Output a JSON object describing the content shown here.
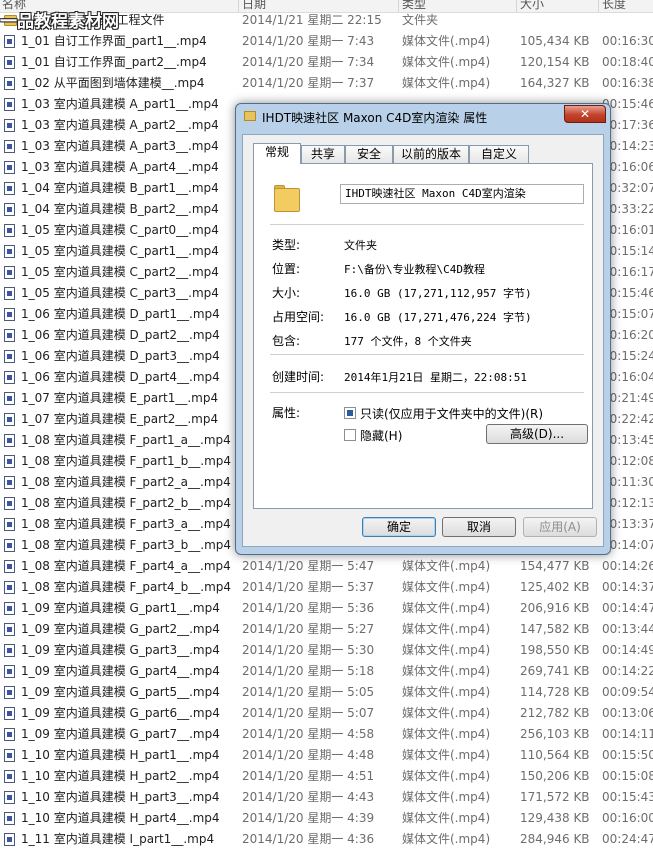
{
  "watermark": "一品教程素材网",
  "columns": {
    "name": "名称",
    "date": "日期",
    "type": "类型",
    "size": "大小",
    "duration": "长度"
  },
  "files": [
    {
      "name": "CINEMA 4D 室内工程文件",
      "date": "2014/1/21 星期二 22:15",
      "type": "文件夹",
      "size": "",
      "duration": "",
      "kind": "folder-icon"
    },
    {
      "name": "1_01 自订工作界面_part1__.mp4",
      "date": "2014/1/20 星期一 7:43",
      "type": "媒体文件(.mp4)",
      "size": "105,434 KB",
      "duration": "00:16:30",
      "kind": "media-file-icon"
    },
    {
      "name": "1_01 自订工作界面_part2__.mp4",
      "date": "2014/1/20 星期一 7:34",
      "type": "媒体文件(.mp4)",
      "size": "120,154 KB",
      "duration": "00:18:40",
      "kind": "media-file-icon"
    },
    {
      "name": "1_02 从平面图到墙体建模__.mp4",
      "date": "2014/1/20 星期一 7:37",
      "type": "媒体文件(.mp4)",
      "size": "164,327 KB",
      "duration": "00:16:38",
      "kind": "media-file-icon"
    },
    {
      "name": "1_03 室内道具建模 A_part1__.mp4",
      "date": "",
      "type": "",
      "size": "",
      "duration": "00:15:46",
      "kind": "media-file-icon"
    },
    {
      "name": "1_03 室内道具建模 A_part2__.mp4",
      "date": "",
      "type": "",
      "size": "",
      "duration": "00:17:36",
      "kind": "media-file-icon"
    },
    {
      "name": "1_03 室内道具建模 A_part3__.mp4",
      "date": "",
      "type": "",
      "size": "",
      "duration": "00:14:23",
      "kind": "media-file-icon"
    },
    {
      "name": "1_03 室内道具建模 A_part4__.mp4",
      "date": "",
      "type": "",
      "size": "",
      "duration": "00:16:06",
      "kind": "media-file-icon"
    },
    {
      "name": "1_04 室内道具建模 B_part1__.mp4",
      "date": "",
      "type": "",
      "size": "",
      "duration": "00:32:07",
      "kind": "media-file-icon"
    },
    {
      "name": "1_04 室内道具建模 B_part2__.mp4",
      "date": "",
      "type": "",
      "size": "",
      "duration": "00:33:22",
      "kind": "media-file-icon"
    },
    {
      "name": "1_05 室内道具建模 C_part0__.mp4",
      "date": "",
      "type": "",
      "size": "",
      "duration": "00:16:01",
      "kind": "media-file-icon"
    },
    {
      "name": "1_05 室内道具建模 C_part1__.mp4",
      "date": "",
      "type": "",
      "size": "",
      "duration": "00:15:14",
      "kind": "media-file-icon"
    },
    {
      "name": "1_05 室内道具建模 C_part2__.mp4",
      "date": "",
      "type": "",
      "size": "",
      "duration": "00:16:17",
      "kind": "media-file-icon"
    },
    {
      "name": "1_05 室内道具建模 C_part3__.mp4",
      "date": "",
      "type": "",
      "size": "",
      "duration": "00:15:46",
      "kind": "media-file-icon"
    },
    {
      "name": "1_06 室内道具建模 D_part1__.mp4",
      "date": "",
      "type": "",
      "size": "",
      "duration": "00:15:07",
      "kind": "media-file-icon"
    },
    {
      "name": "1_06 室内道具建模 D_part2__.mp4",
      "date": "",
      "type": "",
      "size": "",
      "duration": "00:16:20",
      "kind": "media-file-icon"
    },
    {
      "name": "1_06 室内道具建模 D_part3__.mp4",
      "date": "",
      "type": "",
      "size": "",
      "duration": "00:15:24",
      "kind": "media-file-icon"
    },
    {
      "name": "1_06 室内道具建模 D_part4__.mp4",
      "date": "",
      "type": "",
      "size": "",
      "duration": "00:16:04",
      "kind": "media-file-icon"
    },
    {
      "name": "1_07 室内道具建模 E_part1__.mp4",
      "date": "",
      "type": "",
      "size": "",
      "duration": "00:21:49",
      "kind": "media-file-icon"
    },
    {
      "name": "1_07 室内道具建模 E_part2__.mp4",
      "date": "",
      "type": "",
      "size": "",
      "duration": "00:22:42",
      "kind": "media-file-icon"
    },
    {
      "name": "1_08 室内道具建模 F_part1_a__.mp4",
      "date": "",
      "type": "",
      "size": "",
      "duration": "00:13:45",
      "kind": "media-file-icon"
    },
    {
      "name": "1_08 室内道具建模 F_part1_b__.mp4",
      "date": "",
      "type": "",
      "size": "",
      "duration": "00:12:08",
      "kind": "media-file-icon"
    },
    {
      "name": "1_08 室内道具建模 F_part2_a__.mp4",
      "date": "",
      "type": "",
      "size": "",
      "duration": "00:11:30",
      "kind": "media-file-icon"
    },
    {
      "name": "1_08 室内道具建模 F_part2_b__.mp4",
      "date": "",
      "type": "",
      "size": "",
      "duration": "00:12:13",
      "kind": "media-file-icon"
    },
    {
      "name": "1_08 室内道具建模 F_part3_a__.mp4",
      "date": "",
      "type": "",
      "size": "",
      "duration": "00:13:37",
      "kind": "media-file-icon"
    },
    {
      "name": "1_08 室内道具建模 F_part3_b__.mp4",
      "date": "",
      "type": "",
      "size": "",
      "duration": "00:14:07",
      "kind": "media-file-icon"
    },
    {
      "name": "1_08 室内道具建模 F_part4_a__.mp4",
      "date": "2014/1/20 星期一 5:47",
      "type": "媒体文件(.mp4)",
      "size": "154,477 KB",
      "duration": "00:14:26",
      "kind": "media-file-icon"
    },
    {
      "name": "1_08 室内道具建模 F_part4_b__.mp4",
      "date": "2014/1/20 星期一 5:37",
      "type": "媒体文件(.mp4)",
      "size": "125,402 KB",
      "duration": "00:14:37",
      "kind": "media-file-icon"
    },
    {
      "name": "1_09 室内道具建模 G_part1__.mp4",
      "date": "2014/1/20 星期一 5:36",
      "type": "媒体文件(.mp4)",
      "size": "206,916 KB",
      "duration": "00:14:47",
      "kind": "media-file-icon"
    },
    {
      "name": "1_09 室内道具建模 G_part2__.mp4",
      "date": "2014/1/20 星期一 5:27",
      "type": "媒体文件(.mp4)",
      "size": "147,582 KB",
      "duration": "00:13:44",
      "kind": "media-file-icon"
    },
    {
      "name": "1_09 室内道具建模 G_part3__.mp4",
      "date": "2014/1/20 星期一 5:30",
      "type": "媒体文件(.mp4)",
      "size": "198,550 KB",
      "duration": "00:14:49",
      "kind": "media-file-icon"
    },
    {
      "name": "1_09 室内道具建模 G_part4__.mp4",
      "date": "2014/1/20 星期一 5:18",
      "type": "媒体文件(.mp4)",
      "size": "269,741 KB",
      "duration": "00:14:22",
      "kind": "media-file-icon"
    },
    {
      "name": "1_09 室内道具建模 G_part5__.mp4",
      "date": "2014/1/20 星期一 5:05",
      "type": "媒体文件(.mp4)",
      "size": "114,728 KB",
      "duration": "00:09:54",
      "kind": "media-file-icon"
    },
    {
      "name": "1_09 室内道具建模 G_part6__.mp4",
      "date": "2014/1/20 星期一 5:07",
      "type": "媒体文件(.mp4)",
      "size": "212,782 KB",
      "duration": "00:13:06",
      "kind": "media-file-icon"
    },
    {
      "name": "1_09 室内道具建模 G_part7__.mp4",
      "date": "2014/1/20 星期一 4:58",
      "type": "媒体文件(.mp4)",
      "size": "256,103 KB",
      "duration": "00:14:11",
      "kind": "media-file-icon"
    },
    {
      "name": "1_10 室内道具建模 H_part1__.mp4",
      "date": "2014/1/20 星期一 4:48",
      "type": "媒体文件(.mp4)",
      "size": "110,564 KB",
      "duration": "00:15:50",
      "kind": "media-file-icon"
    },
    {
      "name": "1_10 室内道具建模 H_part2__.mp4",
      "date": "2014/1/20 星期一 4:51",
      "type": "媒体文件(.mp4)",
      "size": "150,206 KB",
      "duration": "00:15:08",
      "kind": "media-file-icon"
    },
    {
      "name": "1_10 室内道具建模 H_part3__.mp4",
      "date": "2014/1/20 星期一 4:43",
      "type": "媒体文件(.mp4)",
      "size": "171,572 KB",
      "duration": "00:15:43",
      "kind": "media-file-icon"
    },
    {
      "name": "1_10 室内道具建模 H_part4__.mp4",
      "date": "2014/1/20 星期一 4:39",
      "type": "媒体文件(.mp4)",
      "size": "129,438 KB",
      "duration": "00:16:00",
      "kind": "media-file-icon"
    },
    {
      "name": "1_11 室内道具建模 I_part1__.mp4",
      "date": "2014/1/20 星期一 4:36",
      "type": "媒体文件(.mp4)",
      "size": "284,946 KB",
      "duration": "00:24:47",
      "kind": "media-file-icon"
    }
  ],
  "dialog": {
    "title": "IHDT映速社区 Maxon C4D室内渲染 属性",
    "close_label": "✕",
    "tabs": [
      "常规",
      "共享",
      "安全",
      "以前的版本",
      "自定义"
    ],
    "active_tab": "常规",
    "folder_name": "IHDT映速社区  Maxon C4D室内渲染",
    "props": [
      {
        "label": "类型:",
        "value": "文件夹"
      },
      {
        "label": "位置:",
        "value": "F:\\备份\\专业教程\\C4D教程"
      },
      {
        "label": "大小:",
        "value": "16.0 GB (17,271,112,957 字节)"
      },
      {
        "label": "占用空间:",
        "value": "16.0 GB (17,271,476,224 字节)"
      },
      {
        "label": "包含:",
        "value": "177 个文件，8 个文件夹"
      }
    ],
    "created_label": "创建时间:",
    "created_value": "2014年1月21日 星期二，22:08:51",
    "attributes_label": "属性:",
    "readonly_label": "只读(仅应用于文件夹中的文件)(R)",
    "readonly_checked": true,
    "hidden_label": "隐藏(H)",
    "hidden_checked": false,
    "advanced_label": "高级(D)...",
    "ok_label": "确定",
    "cancel_label": "取消",
    "apply_label": "应用(A)"
  }
}
